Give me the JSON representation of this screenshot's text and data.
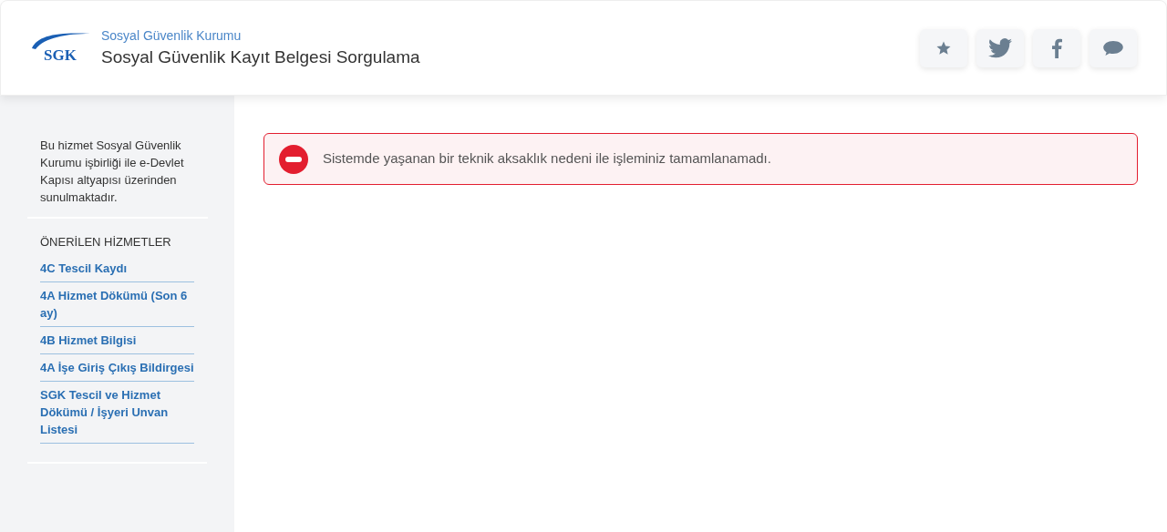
{
  "header": {
    "logo_text": "SGK",
    "organization": "Sosyal Güvenlik Kurumu",
    "title": "Sosyal Güvenlik Kayıt Belgesi Sorgulama",
    "actions": [
      {
        "kind": "star"
      },
      {
        "kind": "twitter"
      },
      {
        "kind": "facebook"
      },
      {
        "kind": "comment"
      }
    ]
  },
  "sidebar": {
    "info": "Bu hizmet Sosyal Güvenlik Kurumu işbirliği ile e-Devlet Kapısı altyapısı üzerinden sunulmaktadır.",
    "section_title": "ÖNERİLEN HİZMETLER",
    "links": [
      "4C Tescil Kaydı",
      "4A Hizmet Dökümü (Son 6 ay)",
      "4B Hizmet Bilgisi",
      "4A İşe Giriş Çıkış Bildirgesi",
      "SGK Tescil ve Hizmet Dökümü / İşyeri Unvan Listesi"
    ]
  },
  "alert": {
    "kind": "error",
    "message": "Sistemde yaşanan bir teknik aksaklık nedeni ile işleminiz tamamlanamadı."
  }
}
